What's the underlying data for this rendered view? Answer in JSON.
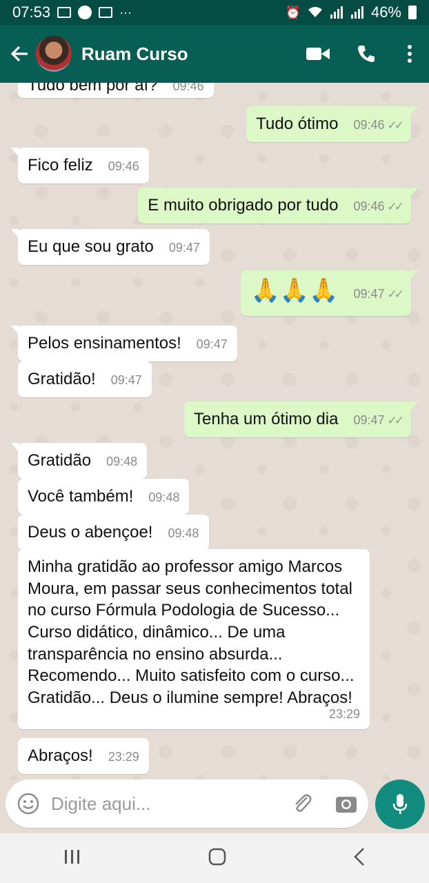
{
  "status_bar": {
    "time": "07:53",
    "battery": "46%"
  },
  "header": {
    "contact_name": "Ruam Curso"
  },
  "messages": [
    {
      "dir": "in",
      "text": "Tudo bem por aí?",
      "time": "09:46"
    },
    {
      "dir": "out",
      "text": "Tudo ótimo",
      "time": "09:46"
    },
    {
      "dir": "in",
      "text": "Fico feliz",
      "time": "09:46"
    },
    {
      "dir": "out",
      "text": "E muito obrigado por tudo",
      "time": "09:46"
    },
    {
      "dir": "in",
      "text": "Eu que sou grato",
      "time": "09:47"
    },
    {
      "dir": "out",
      "text": "🙏🙏🙏",
      "time": "09:47"
    },
    {
      "dir": "in",
      "text": "Pelos ensinamentos!",
      "time": "09:47"
    },
    {
      "dir": "in",
      "text": "Gratidão!",
      "time": "09:47"
    },
    {
      "dir": "out",
      "text": "Tenha um ótimo dia",
      "time": "09:47"
    },
    {
      "dir": "in",
      "text": "Gratidão",
      "time": "09:48"
    },
    {
      "dir": "in",
      "text": "Você também!",
      "time": "09:48"
    },
    {
      "dir": "in",
      "text": "Deus o abençoe!",
      "time": "09:48"
    },
    {
      "dir": "in",
      "text": "Minha gratidão ao professor amigo Marcos Moura, em passar seus conhecimentos total no curso Fórmula Podologia de Sucesso... Curso didático, dinâmico... De uma transparência no ensino absurda... Recomendo... Muito satisfeito com o curso... Gratidão... Deus o ilumine sempre! Abraços!",
      "time": "23:29"
    },
    {
      "dir": "in",
      "text": "Abraços!",
      "time": "23:29"
    }
  ],
  "read_ticks": "✓✓",
  "input": {
    "placeholder": "Digite aqui..."
  },
  "colors": {
    "header": "#075e54",
    "status_bar": "#054d44",
    "outgoing_bubble": "#dcf8c6",
    "incoming_bubble": "#ffffff",
    "chat_background": "#e5ddd5",
    "mic_button": "#128c7e"
  },
  "icons": {
    "back": "arrow-left-icon",
    "video": "video-camera-icon",
    "call": "phone-icon",
    "menu": "more-vert-icon",
    "emoji": "smiley-icon",
    "attach": "paperclip-icon",
    "camera": "camera-icon",
    "mic": "microphone-icon"
  }
}
